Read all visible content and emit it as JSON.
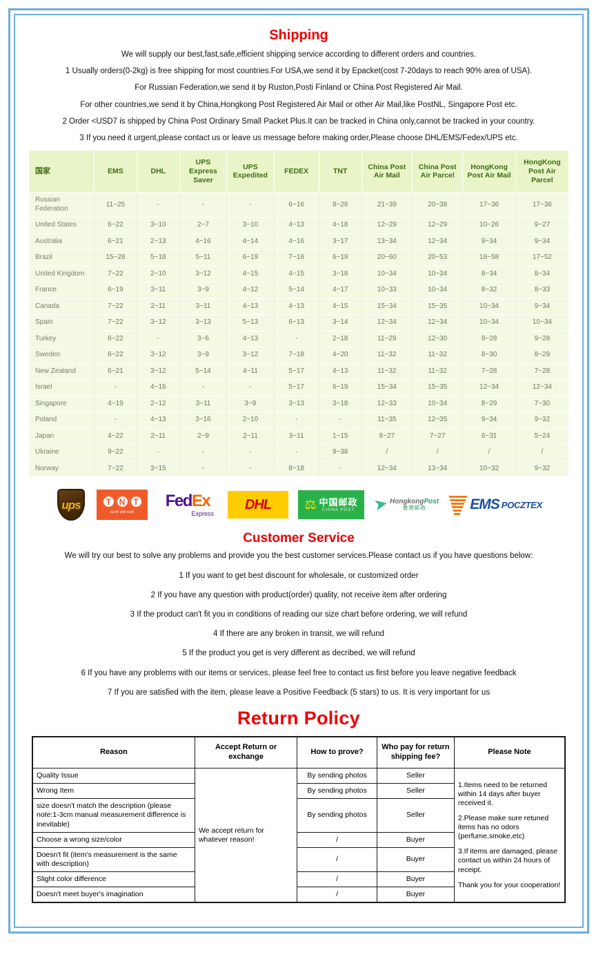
{
  "shipping": {
    "title": "Shipping",
    "intro": [
      "We will supply our best,fast,safe,efficient shipping service according to different orders and countries.",
      "1 Usually orders(0-2kg) is free shipping for most countries.For USA,we send it by Epacket(cost 7-20days to reach 90% area of USA).",
      "For Russian Federation,we send it by Ruston,Posti Finland or China Post Registered Air Mail.",
      "For other countries,we send it by China,Hongkong Post Registered Air Mail or other Air Mail,like PostNL, Singapore Post etc.",
      "2 Order <USD7 is shipped by China Post Ordinary Small Packet Plus.It can be tracked in China only,cannot be tracked in your country.",
      "3 If you need it urgent,please contact us or leave us message before making order,Please choose DHL/EMS/Fedex/UPS etc."
    ],
    "table": {
      "headers": [
        "国家",
        "EMS",
        "DHL",
        "UPS Express Saver",
        "UPS Expedited",
        "FEDEX",
        "TNT",
        "China Post Air Mail",
        "China Post Air Parcel",
        "HongKong Post Air Mail",
        "HongKong Post Air Parcel"
      ],
      "rows": [
        {
          "country": "Russian Federation",
          "values": [
            "11~25",
            "-",
            "-",
            "-",
            "6~16",
            "8~26",
            "21~39",
            "20~38",
            "17~36",
            "17~36"
          ]
        },
        {
          "country": "United States",
          "values": [
            "6~22",
            "3~10",
            "2~7",
            "3~10",
            "4~13",
            "4~18",
            "12~29",
            "12~29",
            "10~26",
            "9~27"
          ]
        },
        {
          "country": "Australia",
          "values": [
            "6~21",
            "2~13",
            "4~16",
            "4~14",
            "4~16",
            "3~17",
            "13~34",
            "12~34",
            "9~34",
            "9~34"
          ]
        },
        {
          "country": "Brazil",
          "values": [
            "15~28",
            "5~18",
            "5~11",
            "6~19",
            "7~18",
            "6~19",
            "20~60",
            "20~53",
            "18~58",
            "17~52"
          ]
        },
        {
          "country": "United Kingdom",
          "values": [
            "7~22",
            "2~10",
            "3~12",
            "4~15",
            "4~15",
            "3~18",
            "10~34",
            "10~34",
            "8~34",
            "8~34"
          ]
        },
        {
          "country": "France",
          "values": [
            "6~19",
            "3~11",
            "3~9",
            "4~12",
            "5~14",
            "4~17",
            "10~33",
            "10~34",
            "8~32",
            "8~33"
          ]
        },
        {
          "country": "Canada",
          "values": [
            "7~22",
            "2~11",
            "3~11",
            "4~13",
            "4~13",
            "4~15",
            "15~34",
            "15~35",
            "10~34",
            "9~34"
          ]
        },
        {
          "country": "Spain",
          "values": [
            "7~22",
            "3~12",
            "3~13",
            "5~13",
            "6~13",
            "3~14",
            "12~34",
            "12~34",
            "10~34",
            "10~34"
          ]
        },
        {
          "country": "Turkey",
          "values": [
            "6~22",
            "-",
            "3~6",
            "4~13",
            "-",
            "2~18",
            "11~29",
            "12~30",
            "9~28",
            "9~28"
          ]
        },
        {
          "country": "Sweden",
          "values": [
            "6~22",
            "3~12",
            "3~9",
            "3~12",
            "7~18",
            "4~20",
            "11~32",
            "11~32",
            "8~30",
            "8~29"
          ]
        },
        {
          "country": "New Zealand",
          "values": [
            "6~21",
            "3~12",
            "5~14",
            "4~11",
            "5~17",
            "4~13",
            "11~32",
            "11~32",
            "7~28",
            "7~28"
          ]
        },
        {
          "country": "Israel",
          "values": [
            "-",
            "4~16",
            "-",
            "-",
            "5~17",
            "6~19",
            "15~34",
            "15~35",
            "12~34",
            "12~34"
          ]
        },
        {
          "country": "Singapore",
          "values": [
            "4~19",
            "2~12",
            "3~11",
            "3~9",
            "3~13",
            "3~18",
            "12~33",
            "10~34",
            "8~29",
            "7~30"
          ]
        },
        {
          "country": "Poland",
          "values": [
            "-",
            "4~13",
            "3~16",
            "2~10",
            "-",
            "-",
            "11~35",
            "12~35",
            "9~34",
            "9~32"
          ]
        },
        {
          "country": "Japan",
          "values": [
            "4~22",
            "2~11",
            "2~9",
            "2~11",
            "3~11",
            "1~15",
            "8~27",
            "7~27",
            "6~31",
            "5~24"
          ]
        },
        {
          "country": "Ukraine",
          "values": [
            "9~22",
            "-",
            "-",
            "-",
            "-",
            "9~38",
            "/",
            "/",
            "/",
            "/"
          ]
        },
        {
          "country": "Norway",
          "values": [
            "7~22",
            "3~15",
            "-",
            "-",
            "8~18",
            "-",
            "12~34",
            "13~34",
            "10~32",
            "9~32"
          ]
        }
      ]
    },
    "logos": [
      {
        "name": "ups-logo",
        "text": "ups"
      },
      {
        "name": "tnt-logo",
        "text": "TNT",
        "sub": "sure we can"
      },
      {
        "name": "fedex-logo",
        "text": "FedEx",
        "sub": "Express"
      },
      {
        "name": "dhl-logo",
        "text": "DHL"
      },
      {
        "name": "china-post-logo",
        "cn": "中国邮政",
        "en": "CHINA POST"
      },
      {
        "name": "hongkong-post-logo",
        "en1": "Hongkong",
        "en2": "Post",
        "cn": "香港邮政"
      },
      {
        "name": "ems-pocztex-logo",
        "text": "EMS",
        "sub": "POCZTEX"
      }
    ]
  },
  "customer_service": {
    "title": "Customer Service",
    "lines": [
      "We will try our best to solve any problems and provide you the best customer services.Please contact us if you have questions below:",
      "1 If you want to get best discount for wholesale, or customized order",
      "2 If you have any question with product(order) quality, not receive item after ordering",
      "3 If the product can't fit you in conditions of reading our size chart before ordering, we will refund",
      "4 If there are any broken in transit, we will refund",
      "5 If the product you get is very different as decribed, we will refund",
      "6 If you have any problems with our items or services, please feel free to contact us first before you leave negative feedback",
      "7 If you are satisfied with the item, please leave a Positive Feedback (5 stars) to us. It is very important for us"
    ]
  },
  "return_policy": {
    "title": "Return Policy",
    "headers": [
      "Reason",
      "Accept Return or exchange",
      "How to prove?",
      "Who pay for return shipping fee?",
      "Please Note"
    ],
    "accept_cell": "We accept return for whatever reason!",
    "rows": [
      {
        "reason": "Quality Issue",
        "prove": "By sending photos",
        "payer": "Seller"
      },
      {
        "reason": "Wrong Item",
        "prove": "By sending photos",
        "payer": "Seller"
      },
      {
        "reason": "size doesn't match the description (please note:1-3cm manual measurement difference is inevitable)",
        "prove": "By sending photos",
        "payer": "Seller"
      },
      {
        "reason": "Choose a wrong size/color",
        "prove": "/",
        "payer": "Buyer"
      },
      {
        "reason": "Doesn't fit (item's measurement is the same with description)",
        "prove": "/",
        "payer": "Buyer"
      },
      {
        "reason": "Slight color difference",
        "prove": "/",
        "payer": "Buyer"
      },
      {
        "reason": "Doesn't meet buyer's imagination",
        "prove": "/",
        "payer": "Buyer"
      }
    ],
    "notes": [
      "1.Items need to be returned within 14 days after buyer received it.",
      "2.Please make sure retuned items has no odors (perfume,smoke,etc)",
      "3.If items are damaged, please contact us within 24 hours of receipt.",
      "Thank you for your cooperation!"
    ]
  },
  "colors": {
    "frame_blue": "#6aaee0",
    "heading_red": "#ee0000",
    "table_header_green": "#e9f5c8",
    "table_header_text": "#3f6b14",
    "table_row_green": "#f3f9e3"
  }
}
